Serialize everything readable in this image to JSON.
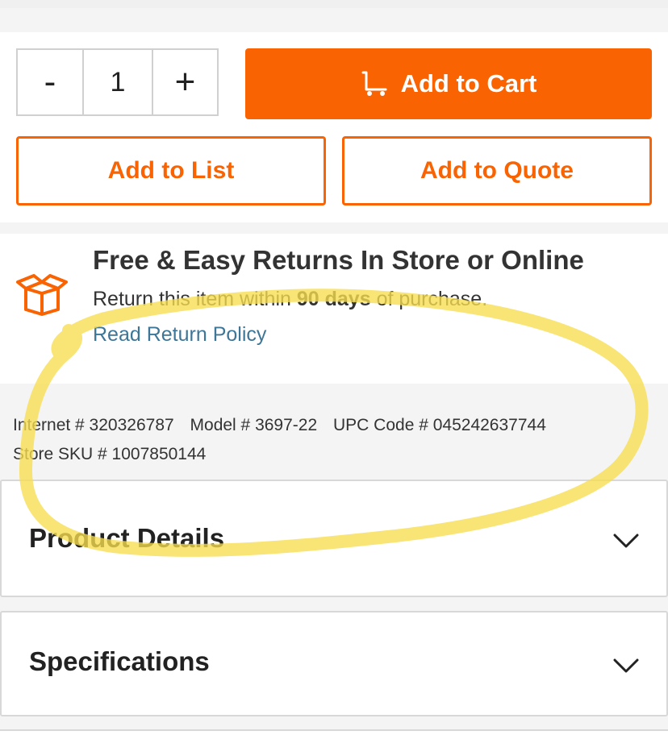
{
  "quantity": {
    "minus_label": "-",
    "value": "1",
    "plus_label": "+"
  },
  "actions": {
    "add_to_cart": "Add to Cart",
    "add_to_list": "Add to List",
    "add_to_quote": "Add to Quote"
  },
  "returns": {
    "title": "Free & Easy Returns In Store or Online",
    "text_before": "Return this item within ",
    "days": "90 days",
    "text_after": " of purchase.",
    "link": "Read Return Policy",
    "icon": "box-icon"
  },
  "codes": {
    "internet": "Internet # 320326787",
    "model": "Model # 3697-22",
    "upc": "UPC Code # 045242637744",
    "sku": "Store SKU # 1007850144"
  },
  "accordions": {
    "details": "Product Details",
    "specs": "Specifications"
  },
  "colors": {
    "brand_orange": "#f96302",
    "link_blue": "#3e7697",
    "highlight_yellow": "#f7dc4f"
  }
}
